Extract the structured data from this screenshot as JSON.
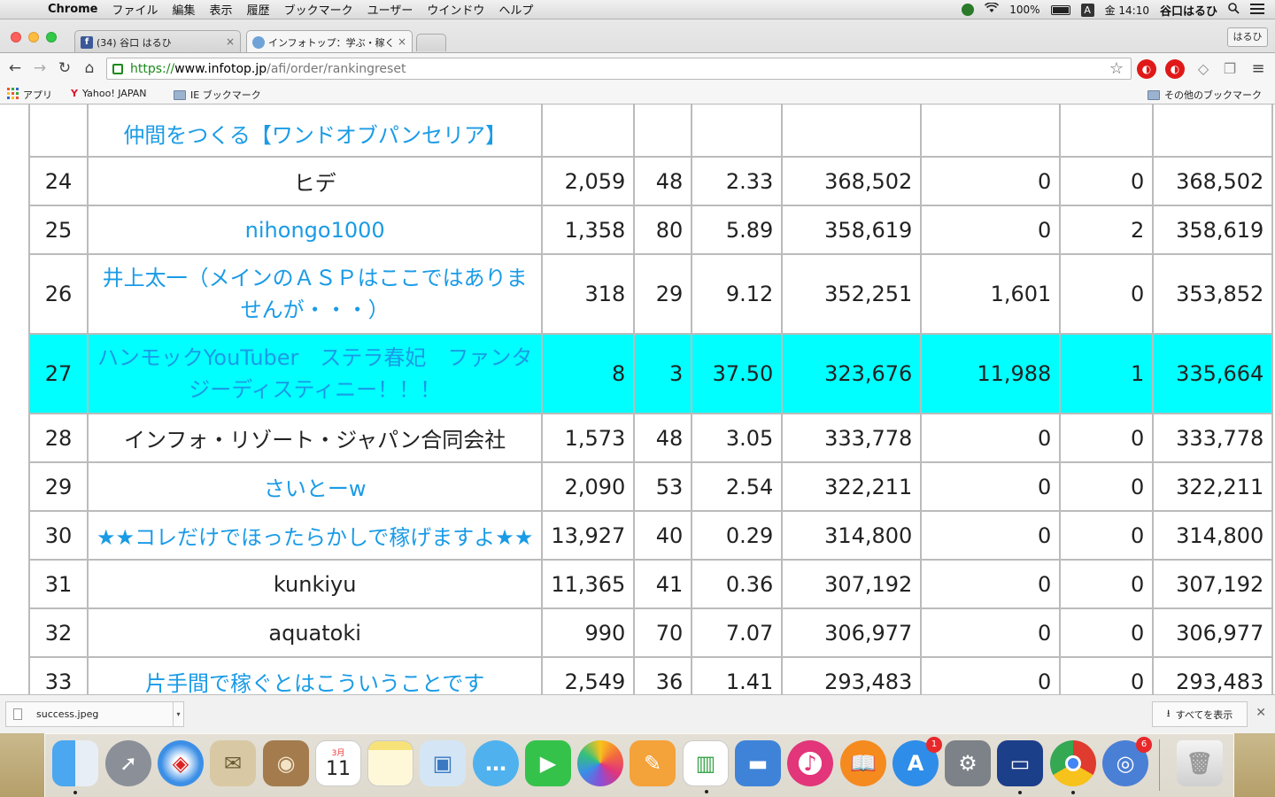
{
  "menubar": {
    "app_name": "Chrome",
    "items": [
      "ファイル",
      "編集",
      "表示",
      "履歴",
      "ブックマーク",
      "ユーザー",
      "ウインドウ",
      "ヘルプ"
    ],
    "battery": "100%",
    "input_source": "A",
    "clock": "金 14:10",
    "user": "谷口はるひ"
  },
  "tabs": [
    {
      "title": "(34) 谷口 はるひ",
      "favicon": "facebook-icon"
    },
    {
      "title": "インフォトップ：学ぶ・稼く",
      "favicon": "globe-icon"
    }
  ],
  "profile_button": "はるひ",
  "omnibox": {
    "scheme": "https://",
    "host": "www.infotop.jp",
    "path": "/afi/order/rankingreset"
  },
  "bookmarks": {
    "apps": "アプリ",
    "yahoo": "Yahoo! JAPAN",
    "ie_folder": "IE ブックマーク",
    "other": "その他のブックマーク"
  },
  "ranking": {
    "partial_top_name": "仲間をつくる【ワンドオブパンセリア】",
    "rows": [
      {
        "rank": "24",
        "name": "ヒデ",
        "link": false,
        "c2": "2,059",
        "c3": "48",
        "c4": "2.33",
        "c5": "368,502",
        "c6": "0",
        "c7": "0",
        "c8": "368,502"
      },
      {
        "rank": "25",
        "name": "nihongo1000",
        "link": true,
        "c2": "1,358",
        "c3": "80",
        "c4": "5.89",
        "c5": "358,619",
        "c6": "0",
        "c7": "2",
        "c8": "358,619"
      },
      {
        "rank": "26",
        "name": "井上太一（メインのＡＳＰはここではありませんが・・・）",
        "link": true,
        "c2": "318",
        "c3": "29",
        "c4": "9.12",
        "c5": "352,251",
        "c6": "1,601",
        "c7": "0",
        "c8": "353,852"
      },
      {
        "rank": "27",
        "name": "ハンモックYouTuber　ステラ春妃　ファンタジーディスティニー！！！",
        "link": true,
        "c2": "8",
        "c3": "3",
        "c4": "37.50",
        "c5": "323,676",
        "c6": "11,988",
        "c7": "1",
        "c8": "335,664",
        "highlight": true
      },
      {
        "rank": "28",
        "name": "インフォ・リゾート・ジャパン合同会社",
        "link": false,
        "c2": "1,573",
        "c3": "48",
        "c4": "3.05",
        "c5": "333,778",
        "c6": "0",
        "c7": "0",
        "c8": "333,778"
      },
      {
        "rank": "29",
        "name": "さいとーw",
        "link": true,
        "c2": "2,090",
        "c3": "53",
        "c4": "2.54",
        "c5": "322,211",
        "c6": "0",
        "c7": "0",
        "c8": "322,211"
      },
      {
        "rank": "30",
        "name": "★★コレだけでほったらかしで稼げますよ★★",
        "link": true,
        "c2": "13,927",
        "c3": "40",
        "c4": "0.29",
        "c5": "314,800",
        "c6": "0",
        "c7": "0",
        "c8": "314,800"
      },
      {
        "rank": "31",
        "name": "kunkiyu",
        "link": false,
        "c2": "11,365",
        "c3": "41",
        "c4": "0.36",
        "c5": "307,192",
        "c6": "0",
        "c7": "0",
        "c8": "307,192"
      },
      {
        "rank": "32",
        "name": "aquatoki",
        "link": false,
        "c2": "990",
        "c3": "70",
        "c4": "7.07",
        "c5": "306,977",
        "c6": "0",
        "c7": "0",
        "c8": "306,977"
      },
      {
        "rank": "33",
        "name": "片手間で稼ぐとはこういうことです",
        "link": true,
        "c2": "2,549",
        "c3": "36",
        "c4": "1.41",
        "c5": "293,483",
        "c6": "0",
        "c7": "0",
        "c8": "293,483"
      }
    ]
  },
  "downloads": {
    "file": "success.jpeg",
    "show_all": "すべてを表示"
  },
  "dock": {
    "calendar_month": "3月",
    "calendar_day": "11",
    "appstore_badge": "1",
    "network_badge": "6",
    "apps": [
      "finder-icon",
      "launchpad-icon",
      "safari-icon",
      "mail-icon",
      "contacts-icon",
      "calendar-icon",
      "notes-icon",
      "preview-icon",
      "messages-icon",
      "facetime-icon",
      "photos-icon",
      "pages-icon",
      "numbers-icon",
      "keynote-icon",
      "itunes-icon",
      "ibooks-icon",
      "appstore-icon",
      "system-preferences-icon",
      "remote-desktop-icon",
      "chrome-icon",
      "network-icon",
      "trash-icon"
    ]
  },
  "colors": {
    "highlight": "#00ffff",
    "link": "#1a9be6",
    "secure": "#1a8a1a"
  }
}
